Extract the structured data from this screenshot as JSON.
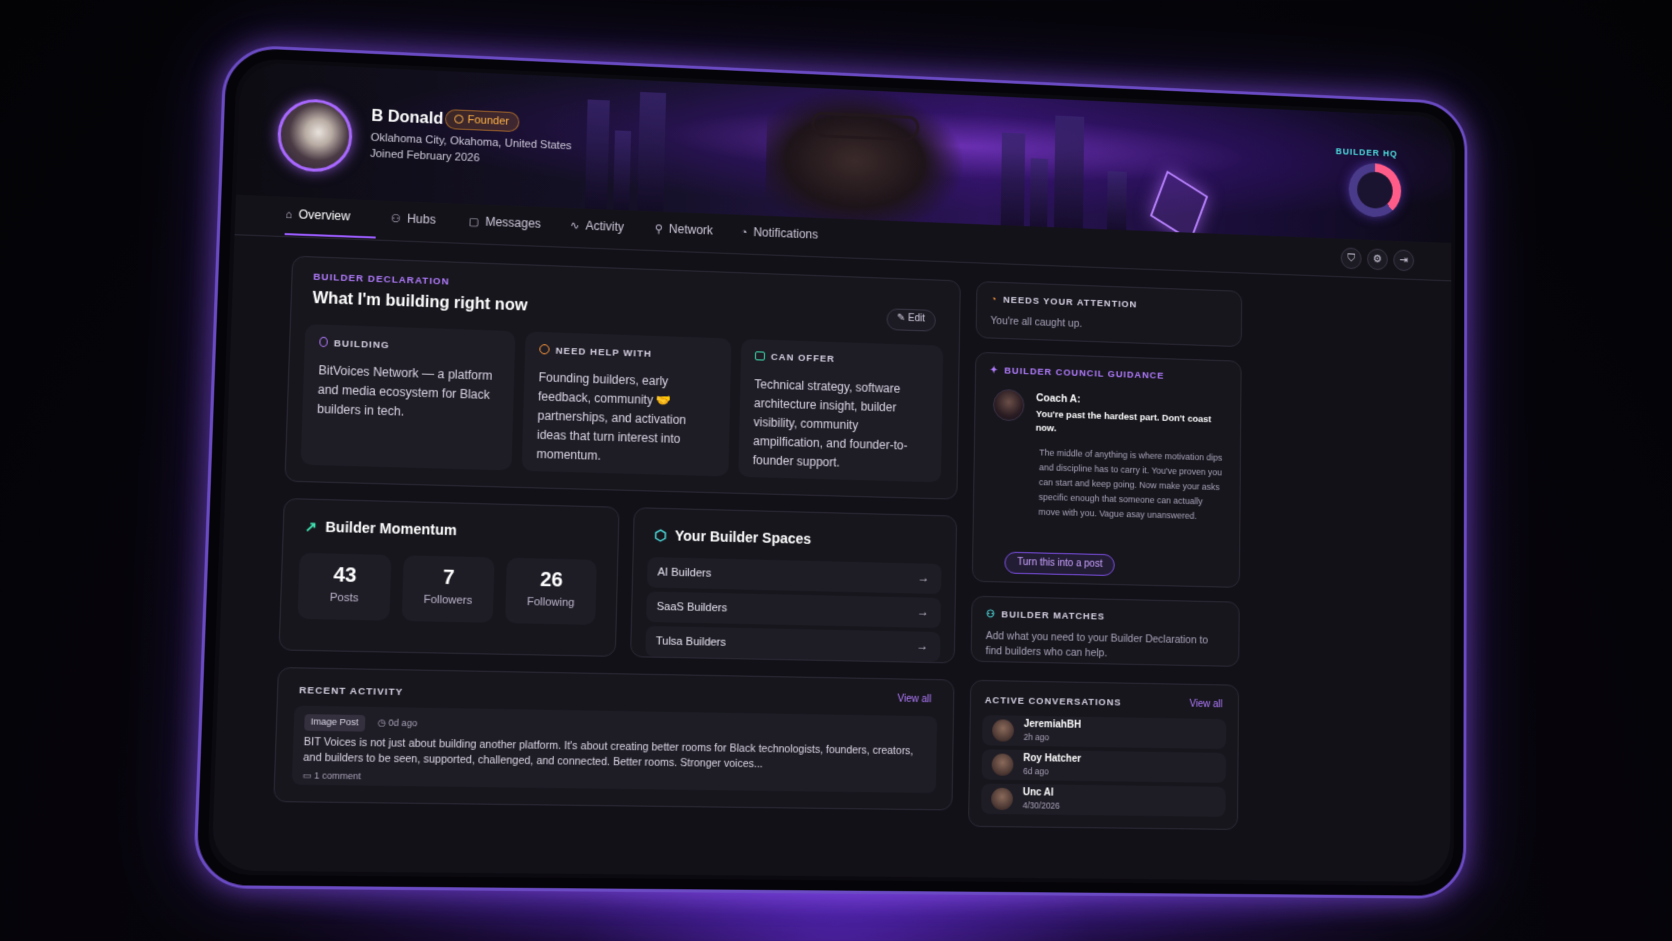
{
  "profile": {
    "name": "B Donald",
    "badge": "Founder",
    "location": "Oklahoma City, Okahoma, United States",
    "joined": "Joined February 2026",
    "hq_label": "BUILDER HQ"
  },
  "nav": {
    "tabs": [
      {
        "label": "Overview",
        "icon": "home-icon",
        "active": true
      },
      {
        "label": "Hubs",
        "icon": "users-icon"
      },
      {
        "label": "Messages",
        "icon": "chat-icon"
      },
      {
        "label": "Activity",
        "icon": "activity-icon"
      },
      {
        "label": "Network",
        "icon": "network-icon"
      },
      {
        "label": "Notifications",
        "icon": "bell-icon"
      }
    ],
    "tools": [
      "shield-icon",
      "gear-icon",
      "logout-icon"
    ]
  },
  "declaration": {
    "overline": "BUILDER DECLARATION",
    "title": "What I'm building right now",
    "edit_label": "Edit",
    "building": {
      "heading": "BUILDING",
      "text": "BitVoices Network — a platform and media ecosystem for Black builders in tech."
    },
    "need_help": {
      "heading": "NEED HELP WITH",
      "text": "Founding builders, early feedback, community 🤝 partnerships, and activation ideas that turn interest into momentum."
    },
    "can_offer": {
      "heading": "CAN OFFER",
      "text": "Technical strategy, software architecture insight, builder visibility, community ampilfication, and founder-to-founder support."
    }
  },
  "momentum": {
    "title": "Builder Momentum",
    "stats": [
      {
        "value": "43",
        "label": "Posts"
      },
      {
        "value": "7",
        "label": "Followers"
      },
      {
        "value": "26",
        "label": "Following"
      }
    ]
  },
  "spaces": {
    "title": "Your Builder Spaces",
    "items": [
      "AI Builders",
      "SaaS Builders",
      "Tulsa Builders"
    ]
  },
  "recent_activity": {
    "label": "RECENT ACTIVITY",
    "view_all": "View all",
    "item": {
      "tag": "Image Post",
      "ago": "0d ago",
      "text": "BIT Voices is not just about building another platform. It's about creating better rooms for Black technologists, founders, creators, and builders to be seen, supported, challenged, and connected. Better rooms. Stronger voices...",
      "comments": "1 comment"
    }
  },
  "attention": {
    "heading": "NEEDS YOUR ATTENTION",
    "text": "You're all caught up."
  },
  "council": {
    "heading": "BUILDER COUNCIL GUIDANCE",
    "coach": "Coach A:",
    "headline": "You're past the hardest part. Don't coast now.",
    "body": "The middle of anything is where motivation dips and discipline has to carry it. You've proven you can start and keep going. Now make your asks specific enough that someone can actually move with you. Vague asay unanswered.",
    "button": "Turn this into a post"
  },
  "matches": {
    "heading": "BUILDER MATCHES",
    "text": "Add what you need to your Builder Declaration to find builders who can help."
  },
  "conversations": {
    "heading": "ACTIVE CONVERSATIONS",
    "view_all": "View all",
    "items": [
      {
        "name": "JeremiahBH",
        "time": "2h ago"
      },
      {
        "name": "Roy Hatcher",
        "time": "6d ago"
      },
      {
        "name": "Unc Al",
        "time": "4/30/2026"
      }
    ]
  },
  "colors": {
    "accent": "#9b5cff",
    "founder": "#ffb347",
    "hq": "#4de0e0",
    "background": "#121118"
  }
}
